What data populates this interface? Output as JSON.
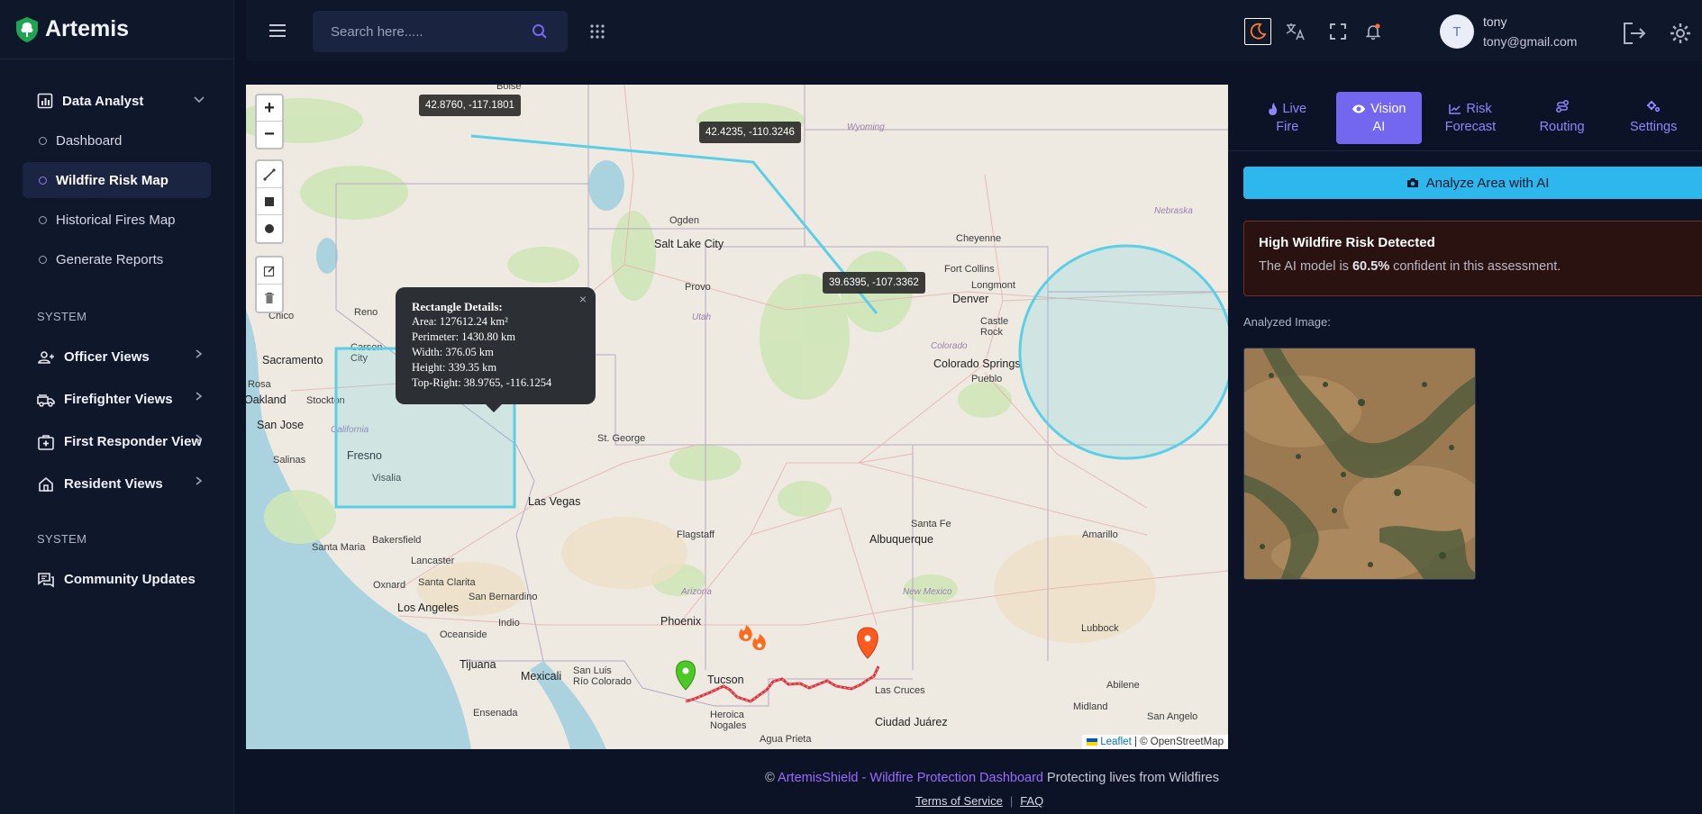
{
  "brand": {
    "name": "Artemis"
  },
  "sidebar": {
    "parent": {
      "label": "Data Analyst"
    },
    "sub_items": [
      {
        "label": "Dashboard"
      },
      {
        "label": "Wildfire Risk Map"
      },
      {
        "label": "Historical Fires Map"
      },
      {
        "label": "Generate Reports"
      }
    ],
    "section1": "SYSTEM",
    "groups": [
      {
        "label": "Officer Views"
      },
      {
        "label": "Firefighter Views"
      },
      {
        "label": "First Responder View"
      },
      {
        "label": "Resident Views"
      }
    ],
    "section2": "SYSTEM",
    "community": {
      "label": "Community Updates"
    }
  },
  "header": {
    "search_placeholder": "Search here.....",
    "user": {
      "initial": "T",
      "name": "tony",
      "email": "tony@gmail.com"
    }
  },
  "map": {
    "zoom_in": "+",
    "zoom_out": "−",
    "tooltips": [
      {
        "text": "42.8760, -117.1801"
      },
      {
        "text": "42.4235, -110.3246"
      },
      {
        "text": "39.6395, -107.3362"
      }
    ],
    "popup": {
      "title": "Rectangle Details:",
      "area": "Area: 127612.24 km²",
      "perimeter": "Perimeter: 1430.80 km",
      "width": "Width: 376.05 km",
      "height": "Height: 339.35 km",
      "top_right": "Top-Right: 38.9765, -116.1254",
      "close": "×"
    },
    "labels": {
      "boise": "Boise",
      "wyoming": "Wyoming",
      "nebraska": "Nebraska",
      "ogden": "Ogden",
      "slc": "Salt Lake City",
      "cheyenne": "Cheyenne",
      "fort_collins": "Fort Collins",
      "longmont": "Longmont",
      "denver": "Denver",
      "castle_rock": "Castle\nRock",
      "provo": "Provo",
      "utah": "Utah",
      "chico": "Chico",
      "reno": "Reno",
      "carson": "Carson\nCity",
      "sacramento": "Sacramento",
      "colorado": "Colorado",
      "colorado_springs": "Colorado Springs",
      "pueblo": "Pueblo",
      "rosa": "Rosa",
      "oakland": "Oakland",
      "stockton": "Stockton",
      "san_jose": "San Jose",
      "california": "California",
      "salinas": "Salinas",
      "fresno": "Fresno",
      "visalia": "Visalia",
      "st_george": "St. George",
      "las_vegas": "Las Vegas",
      "santa_fe": "Santa Fe",
      "bakersfield": "Bakersfield",
      "flagstaff": "Flagstaff",
      "albuquerque": "Albuquerque",
      "amarillo": "Amarillo",
      "santa_maria": "Santa Maria",
      "lancaster": "Lancaster",
      "oxnard": "Oxnard",
      "santa_clarita": "Santa Clarita",
      "san_bernardino": "San Bernardino",
      "los_angeles": "Los Angeles",
      "arizona": "Arizona",
      "new_mexico": "New Mexico",
      "indio": "Indio",
      "oceanside": "Oceanside",
      "phoenix": "Phoenix",
      "lubbock": "Lubbock",
      "tijuana": "Tijuana",
      "mexicali": "Mexicali",
      "san_luis": "San Luis\nRío Colorado",
      "tucson": "Tucson",
      "las_cruces": "Las Cruces",
      "abilene": "Abilene",
      "midland": "Midland",
      "ensenada": "Ensenada",
      "heroica": "Heroica\nNogales",
      "ciudad_juarez": "Ciudad Juárez",
      "san_angelo": "San Angelo",
      "agua_prieta": "Agua Prieta"
    },
    "attribution": {
      "leaflet": "Leaflet",
      "rest": " | © OpenStreetMap"
    }
  },
  "panel": {
    "tabs": [
      {
        "l1": "Live",
        "l2": "Fire",
        "icon": "flame-icon"
      },
      {
        "l1": "Vision",
        "l2": "AI",
        "icon": "eye-icon"
      },
      {
        "l1": "Risk",
        "l2": "Forecast",
        "icon": "chart-line-icon"
      },
      {
        "l1": "Routing",
        "l2": "",
        "icon": "route-icon"
      },
      {
        "l1": "Settings",
        "l2": "",
        "icon": "gears-icon"
      }
    ],
    "active_tab": "Vision AI",
    "analyze_label": "Analyze Area with AI",
    "alert": {
      "title": "High Wildfire Risk Detected",
      "desc_prefix": "The AI model is ",
      "confidence": "60.5%",
      "desc_suffix": " confident in this assessment."
    },
    "analyzed_label": "Analyzed Image:"
  },
  "footer": {
    "copyright": "©",
    "brand": "ArtemisShield - Wildfire Protection Dashboard",
    "tagline": " Protecting lives from Wildfires",
    "terms": "Terms of Service",
    "faq": "FAQ"
  },
  "colors": {
    "accent": "#7367f0",
    "analyze": "#2eb7ec",
    "alert_bg": "#2a1211",
    "route": "#e0303a",
    "shape": "#5ccfe6"
  }
}
